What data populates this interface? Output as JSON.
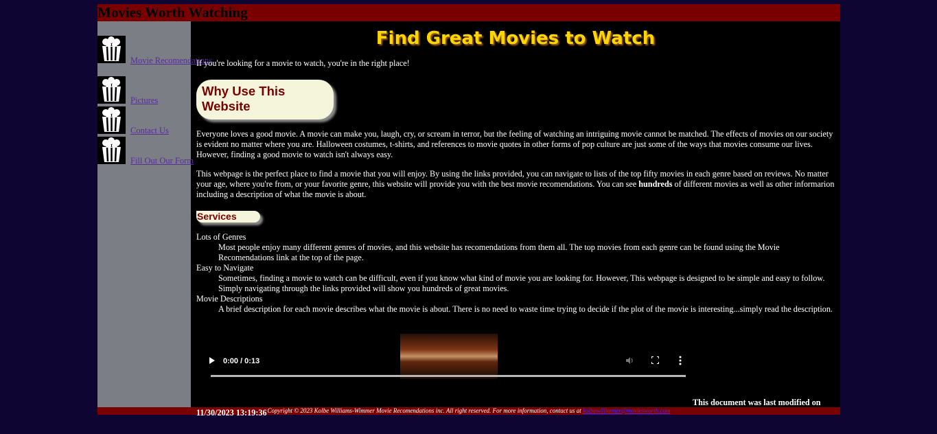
{
  "header": {
    "site_title": "Movies Worth Watching"
  },
  "nav": {
    "items": [
      {
        "label": "Movie Recomendations",
        "icon": "popcorn-icon"
      },
      {
        "label": "Pictures",
        "icon": "popcorn-icon"
      },
      {
        "label": "Contact Us",
        "icon": "popcorn-icon"
      },
      {
        "label": "Fill Out Our Form",
        "icon": "popcorn-icon"
      }
    ]
  },
  "main": {
    "title": "Find Great Movies to Watch",
    "intro": "If you're looking for a movie to watch, you're in the right place!",
    "why_heading": "Why Use This Website",
    "why_paragraph": "Everyone loves a good movie. A movie can make you, laugh, cry, or scream in terror, but the feeling of watching an intriguing movie cannot be matched. The effects of movies on our society is evident no matter where you are. Halloween costumes, t-shirts, and references to movie quotes in other forms of pop culture are just some of the ways that movies consume our lives. However, finding a good movie to watch isn't always easy.",
    "perfect_paragraph_before": "This webpage is the perfect place to find a movie that you will enjoy. By using the links provided, you can navigate to lists of the top fifty movies in each genre based on reviews. No matter your age, where you're from, or your favorite genre, this website will provide you with the best movie recomendations. You can see ",
    "perfect_paragraph_bold": "hundreds",
    "perfect_paragraph_after": " of different movies as well as other informarion including a description of what the movie is about.",
    "services_heading": "Services",
    "services": [
      {
        "term": "Lots of Genres",
        "description": "Most people enjoy many different genres of movies, and this website has recomendations from them all. The top movies from each genre can be found using the Movie Recomendations link at the top of the page."
      },
      {
        "term": "Easy to Navigate",
        "description": "Sometimes, finding a movie to watch can be difficult, even if you know what kind of movie you are looking for. However, This webpage is designed to be simple and easy to follow. Simply navigating through the links provided will show you hundreds of great movies."
      },
      {
        "term": "Movie Descriptions",
        "description": "A brief description for each movie describes what the movie is about. There is no need to waste time trying to decide if the plot of the movie is interesting...simply read the description."
      }
    ],
    "video": {
      "time": "0:00 / 0:13",
      "progress": 0
    },
    "modified_label": "This document was last modified on",
    "modified_date": "11/30/2023 13:19:36"
  },
  "footer": {
    "copyright": "Copyright © 2023 Kolbe Williams-Wimmer Movie Recomendations inc. All right reserved. For more information, contact us at",
    "email": "kolbewillimmer@moviesworth.com"
  },
  "colors": {
    "page_bg": "#0f0533",
    "header_bg": "#7a0000",
    "nav_bg": "#7b7e85",
    "title": "#ffd500",
    "heading_box_bg": "#f5f5dc",
    "heading_text": "#7a0000",
    "link": "#5a2aa0"
  }
}
